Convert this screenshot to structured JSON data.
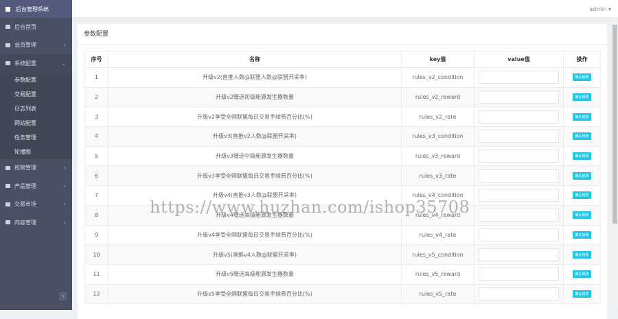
{
  "brand": "后台管理系统",
  "user": "admin",
  "sidebar": {
    "items": [
      {
        "label": "后台首页"
      },
      {
        "label": "会员管理"
      },
      {
        "label": "系统配置"
      },
      {
        "label": "权限管理"
      },
      {
        "label": "产品管理"
      },
      {
        "label": "交易市场"
      },
      {
        "label": "内容管理"
      }
    ],
    "sub": [
      "参数配置",
      "交易配置",
      "日志列表",
      "网站配置",
      "任务管理",
      "轮播图"
    ]
  },
  "page_title": "参数配置",
  "table": {
    "headers": [
      "序号",
      "名称",
      "key值",
      "value值",
      "操作"
    ],
    "button_label": "确认修改",
    "rows": [
      {
        "no": "1",
        "name": "升级v2(直推人数@联盟人数@联盟开采率)",
        "key": "rules_v2_condition"
      },
      {
        "no": "2",
        "name": "升级v2赠送初级能源发生器数量",
        "key": "rules_v2_reward"
      },
      {
        "no": "3",
        "name": "升级v2享受全网联盟每日交易手续费百分比(%)",
        "key": "rules_v2_rate"
      },
      {
        "no": "4",
        "name": "升级v3(直推v2人数@联盟开采率)",
        "key": "rules_v3_condition"
      },
      {
        "no": "5",
        "name": "升级v3赠送中级能源发生器数量",
        "key": "rules_v3_reward"
      },
      {
        "no": "6",
        "name": "升级v3享受全网联盟每日交易手续费百分比(%)",
        "key": "rules_v3_rate"
      },
      {
        "no": "7",
        "name": "升级v4(直推v3人数@联盟开采率)",
        "key": "rules_v4_condition"
      },
      {
        "no": "8",
        "name": "升级v4赠送高级能源发生器数量",
        "key": "rules_v4_reward"
      },
      {
        "no": "9",
        "name": "升级v4享受全网联盟每日交易手续费百分比(%)",
        "key": "rules_v4_rate"
      },
      {
        "no": "10",
        "name": "升级v5(直推v4人数@联盟开采率)",
        "key": "rules_v5_condition"
      },
      {
        "no": "11",
        "name": "升级v5赠送高级能源发生器数量",
        "key": "rules_v5_reward"
      },
      {
        "no": "12",
        "name": "升级v5享受全网联盟每日交易手续费百分比(%)",
        "key": "rules_v5_rate"
      }
    ]
  },
  "watermark": "https://www.huzhan.com/ishop35708"
}
